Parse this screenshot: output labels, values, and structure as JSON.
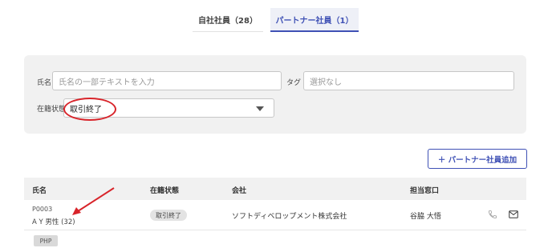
{
  "tabs": [
    {
      "label": "自社社員（28）"
    },
    {
      "label": "パートナー社員（1）"
    }
  ],
  "filter": {
    "name_label": "氏名",
    "name_placeholder": "氏名の一部テキストを入力",
    "tag_label": "タグ",
    "tag_placeholder": "選択なし",
    "status_label": "在籍状態",
    "status_value": "取引終了"
  },
  "add_button": "＋ パートナー社員追加",
  "table": {
    "headers": [
      "氏名",
      "在籍状態",
      "会社",
      "担当窓口"
    ],
    "rows": [
      {
        "id": "P0003",
        "name": "A Y 男性 (32)",
        "status": "取引終了",
        "company": "ソフトディベロップメント株式会社",
        "contact": "谷脇 大悟",
        "skill": "PHP"
      }
    ]
  },
  "colors": {
    "accent": "#3f51b5",
    "annotation_red": "#d8242a"
  },
  "icons": [
    "phone-icon",
    "mail-icon",
    "dropdown-caret-icon"
  ]
}
